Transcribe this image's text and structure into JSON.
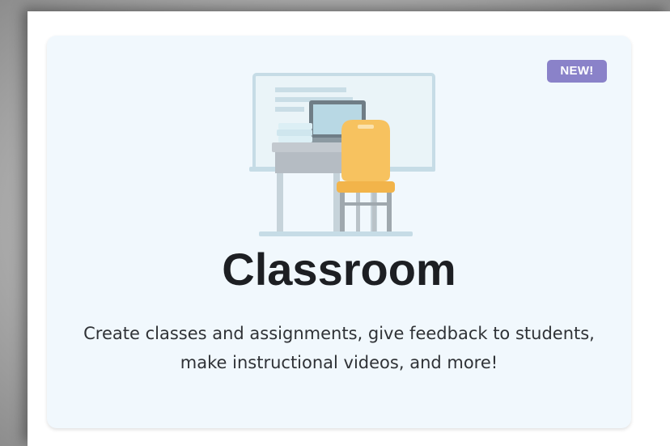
{
  "card": {
    "badge": "NEW!",
    "title": "Classroom",
    "description": "Create classes and assignments, give feedback to students, make instructional videos, and more!",
    "illustration_icon": "classroom-desk-chair-icon"
  },
  "colors": {
    "card_background": "#f1f8fd",
    "badge_background": "#8a82c9",
    "chair": "#f7c25f",
    "whiteboard_frame": "#cfe3ec"
  }
}
